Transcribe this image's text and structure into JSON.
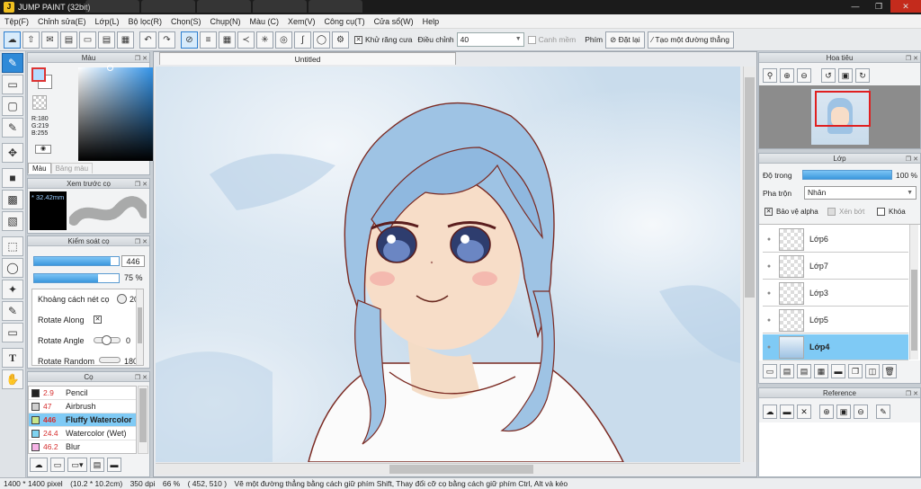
{
  "window": {
    "title": "JUMP PAINT (32bit)"
  },
  "menu": [
    "Tệp(F)",
    "Chỉnh sửa(E)",
    "Lớp(L)",
    "Bộ lọc(R)",
    "Chọn(S)",
    "Chụp(N)",
    "Màu (C)",
    "Xem(V)",
    "Công cụ(T)",
    "Cửa sổ(W)",
    "Help"
  ],
  "toolbar": {
    "antialias_label": "Khử răng cưa",
    "adjust_label": "Điều chỉnh",
    "adjust_value": "40",
    "smooth_label": "Canh mềm",
    "keys_label": "Phím",
    "reset_label": "Đặt lại",
    "straight_line_label": "Tạo một đường thẳng"
  },
  "color_panel": {
    "title": "Màu",
    "r": "R:180",
    "g": "G:219",
    "b": "B:255",
    "tab_color": "Màu",
    "tab_palette": "Bảng màu",
    "fg_color": "#b4dbff",
    "bg_color": "#ffffff"
  },
  "brush_preview": {
    "title": "Xem trước cọ",
    "size": "* 32.42mm"
  },
  "brush_control": {
    "title": "Kiểm soát cọ",
    "size_value": "446",
    "opacity_value": "75 %",
    "size_level": 0.9,
    "opacity_level": 0.75,
    "spacing_label": "Khoảng cách nét cọ",
    "spacing_value": "20",
    "rotate_along_label": "Rotate Along",
    "rotate_angle_label": "Rotate Angle",
    "rotate_angle_value": "0",
    "rotate_random_label": "Rotate Random",
    "rotate_random_value": "180"
  },
  "brushes": {
    "title": "Cọ",
    "items": [
      {
        "size": "2.9",
        "name": "Pencil",
        "color": "#222222"
      },
      {
        "size": "47",
        "name": "Airbrush",
        "color": "#cfcfcf"
      },
      {
        "size": "446",
        "name": "Fluffy Watercolor",
        "color": "#c8e68a"
      },
      {
        "size": "24.4",
        "name": "Watercolor (Wet)",
        "color": "#7fd3f0"
      },
      {
        "size": "46.2",
        "name": "Blur",
        "color": "#f6b3e6"
      }
    ]
  },
  "document": {
    "tab_title": "Untitled"
  },
  "navigator": {
    "title": "Hoa tiêu"
  },
  "layers": {
    "title": "Lớp",
    "opacity_label": "Độ trong",
    "opacity_value": "100 %",
    "opacity_level": 1.0,
    "blend_label": "Pha trộn",
    "blend_value": "Nhân",
    "protect_alpha_label": "Bảo vệ alpha",
    "clip_label": "Xén bớt",
    "lock_label": "Khóa",
    "items": [
      {
        "name": "Lớp6"
      },
      {
        "name": "Lớp7"
      },
      {
        "name": "Lớp3"
      },
      {
        "name": "Lớp5"
      },
      {
        "name": "Lớp4"
      }
    ]
  },
  "reference": {
    "title": "Reference"
  },
  "status": {
    "canvas_size": "1400 * 1400 pixel",
    "canvas_cm": "(10.2 * 10.2cm)",
    "dpi": "350 dpi",
    "zoom": "66 %",
    "coords": "( 452, 510 )",
    "hint": "Vẽ một đường thẳng bằng cách giữ phím Shift, Thay đổi cỡ cọ bằng cách giữ phím Ctrl, Alt và kéo"
  }
}
